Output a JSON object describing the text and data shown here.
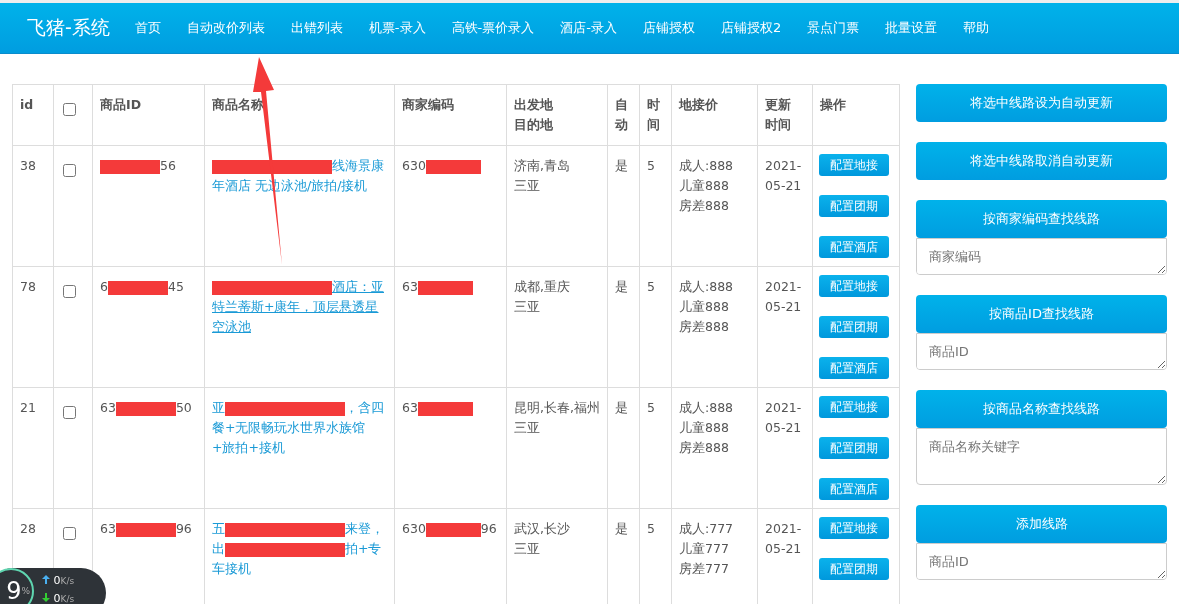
{
  "navbar": {
    "brand": "飞猪-系统",
    "items": [
      {
        "label": "首页"
      },
      {
        "label": "自动改价列表"
      },
      {
        "label": "出错列表"
      },
      {
        "label": "机票-录入"
      },
      {
        "label": "高铁-票价录入"
      },
      {
        "label": "酒店-录入"
      },
      {
        "label": "店铺授权"
      },
      {
        "label": "店铺授权2"
      },
      {
        "label": "景点门票"
      },
      {
        "label": "批量设置"
      },
      {
        "label": "帮助"
      }
    ]
  },
  "table": {
    "columns": [
      {
        "lines": [
          "id"
        ],
        "kind": "text"
      },
      {
        "kind": "checkbox"
      },
      {
        "lines": [
          "商品ID"
        ],
        "kind": "text"
      },
      {
        "lines": [
          "商品名称"
        ],
        "kind": "text"
      },
      {
        "lines": [
          "商家编码"
        ],
        "kind": "text"
      },
      {
        "lines": [
          "出发地",
          "目的地"
        ],
        "kind": "text"
      },
      {
        "lines": [
          "自",
          "动"
        ],
        "kind": "text"
      },
      {
        "lines": [
          "时",
          "间"
        ],
        "kind": "text"
      },
      {
        "lines": [
          "地接价"
        ],
        "kind": "text"
      },
      {
        "lines": [
          "更新",
          "时间"
        ],
        "kind": "text"
      },
      {
        "lines": [
          "操作"
        ],
        "kind": "text"
      }
    ],
    "select_all": {
      "checked": false
    },
    "rows": [
      {
        "id": "38",
        "checked": false,
        "product_id": [
          {
            "kind": "redaction"
          },
          {
            "kind": "text",
            "text": "56"
          }
        ],
        "name": [
          {
            "kind": "redaction"
          },
          {
            "kind": "text",
            "text": "线海景康年酒店 无边泳池/旅拍/接机"
          }
        ],
        "underlined": false,
        "merchant_code": [
          {
            "kind": "text",
            "text": "630"
          },
          {
            "kind": "redaction"
          }
        ],
        "origin": "济南,青岛",
        "destination": "三亚",
        "auto": "是",
        "days": "5",
        "prices": [
          "成人:888",
          "儿童888",
          "房差888"
        ],
        "updated": [
          "2021-",
          "05-21"
        ],
        "actions": [
          "配置地接",
          "配置团期",
          "配置酒店"
        ]
      },
      {
        "id": "78",
        "checked": false,
        "product_id": [
          {
            "kind": "text",
            "text": "6"
          },
          {
            "kind": "redaction"
          },
          {
            "kind": "text",
            "text": "45"
          }
        ],
        "name": [
          {
            "kind": "redaction"
          },
          {
            "kind": "text",
            "text": "酒店：亚特兰蒂斯+康年，顶层悬透星空泳池"
          }
        ],
        "underlined": true,
        "merchant_code": [
          {
            "kind": "text",
            "text": "63"
          },
          {
            "kind": "redaction"
          }
        ],
        "origin": "成都,重庆",
        "destination": "三亚",
        "auto": "是",
        "days": "5",
        "prices": [
          "成人:888",
          "儿童888",
          "房差888"
        ],
        "updated": [
          "2021-",
          "05-21"
        ],
        "actions": [
          "配置地接",
          "配置团期",
          "配置酒店"
        ]
      },
      {
        "id": "21",
        "checked": false,
        "product_id": [
          {
            "kind": "text",
            "text": "63"
          },
          {
            "kind": "redaction"
          },
          {
            "kind": "text",
            "text": "50"
          }
        ],
        "name": [
          {
            "kind": "text",
            "text": "亚"
          },
          {
            "kind": "redaction"
          },
          {
            "kind": "text",
            "text": "，含四餐+无限畅玩水世界水族馆+旅拍+接机"
          }
        ],
        "underlined": false,
        "merchant_code": [
          {
            "kind": "text",
            "text": "63"
          },
          {
            "kind": "redaction"
          }
        ],
        "origin": "昆明,长春,福州",
        "destination": "三亚",
        "auto": "是",
        "days": "5",
        "prices": [
          "成人:888",
          "儿童888",
          "房差888"
        ],
        "updated": [
          "2021-",
          "05-21"
        ],
        "actions": [
          "配置地接",
          "配置团期",
          "配置酒店"
        ]
      },
      {
        "id": "28",
        "checked": false,
        "product_id": [
          {
            "kind": "text",
            "text": "63"
          },
          {
            "kind": "redaction"
          },
          {
            "kind": "text",
            "text": "96"
          }
        ],
        "name": [
          {
            "kind": "text",
            "text": "五"
          },
          {
            "kind": "redaction"
          },
          {
            "kind": "text",
            "text": "来登，出"
          },
          {
            "kind": "redaction"
          },
          {
            "kind": "text",
            "text": "拍+专车接机"
          }
        ],
        "underlined": false,
        "merchant_code": [
          {
            "kind": "text",
            "text": "630"
          },
          {
            "kind": "redaction"
          },
          {
            "kind": "text",
            "text": "96"
          }
        ],
        "origin": "武汉,长沙",
        "destination": "三亚",
        "auto": "是",
        "days": "5",
        "prices": [
          "成人:777",
          "儿童777",
          "房差777"
        ],
        "updated": [
          "2021-",
          "05-21"
        ],
        "actions": [
          "配置地接",
          "配置团期"
        ]
      }
    ]
  },
  "sidebar": [
    {
      "button": "将选中线路设为自动更新"
    },
    {
      "button": "将选中线路取消自动更新"
    },
    {
      "button": "按商家编码查找线路",
      "placeholder": "商家编码",
      "tall": false
    },
    {
      "button": "按商品ID查找线路",
      "placeholder": "商品ID",
      "tall": false
    },
    {
      "button": "按商品名称查找线路",
      "placeholder": "商品名称关键字",
      "tall": true
    },
    {
      "button": "添加线路",
      "placeholder": "商品ID",
      "tall": false
    }
  ],
  "speed_widget": {
    "percent": "9",
    "unit": "%",
    "upload": "0",
    "upload_unit": "K/s",
    "download": "0",
    "download_unit": "K/s"
  }
}
